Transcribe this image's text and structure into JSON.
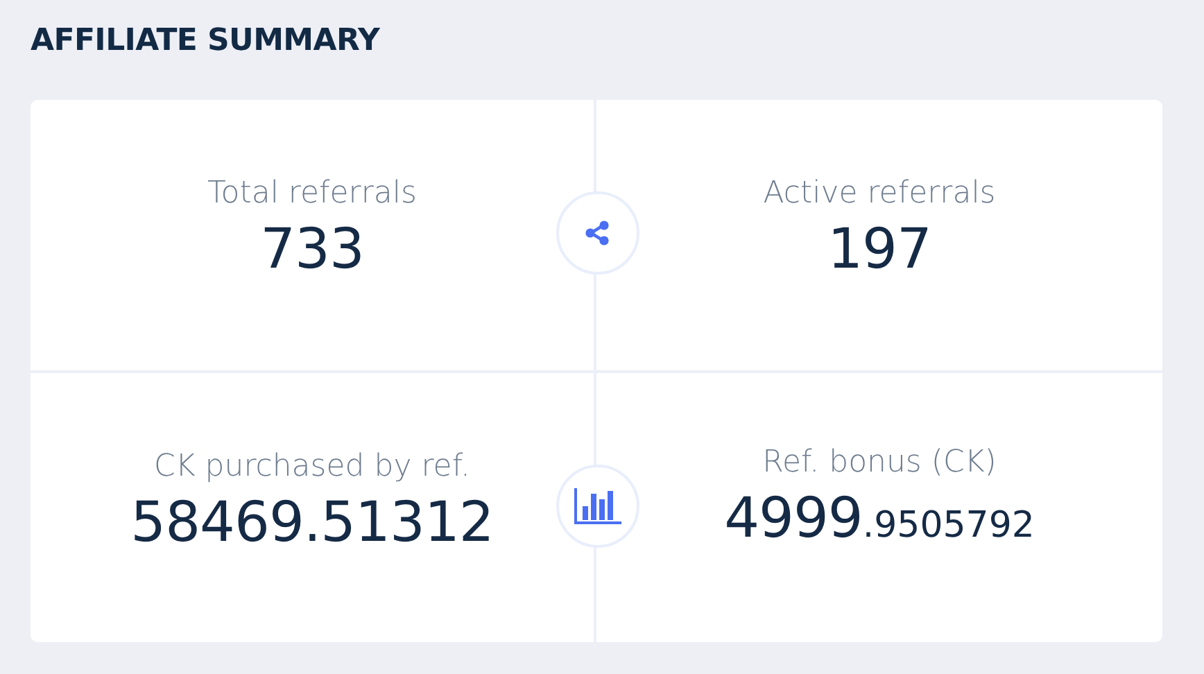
{
  "title": "AFFILIATE SUMMARY",
  "rows": [
    {
      "stats": [
        {
          "label": "Total referrals",
          "value": "733"
        },
        {
          "label": "Active referrals",
          "value": "197"
        }
      ]
    },
    {
      "stats": [
        {
          "label": "CK purchased by ref.",
          "value": "58469.51312"
        },
        {
          "label": "Ref. bonus (CK)",
          "value": "4999",
          "fraction": ".9505792"
        }
      ]
    }
  ]
}
